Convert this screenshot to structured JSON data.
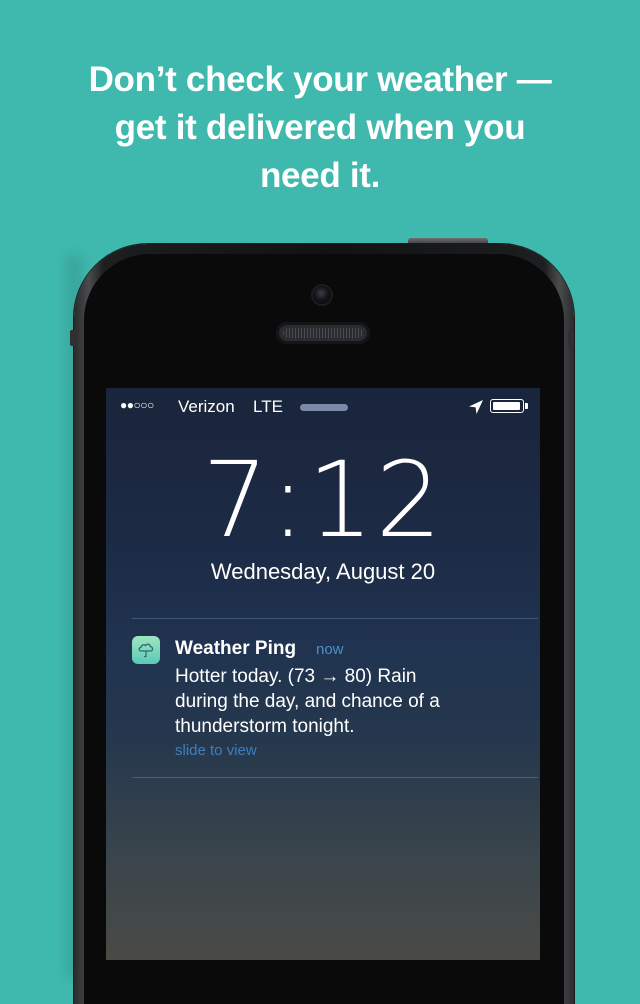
{
  "headline": {
    "lines": [
      "Don’t check your weather —",
      "get it delivered when you",
      "need it."
    ]
  },
  "colors": {
    "background": "#3fb8ad",
    "link_blue": "#4d8fc7",
    "text": "#ffffff"
  },
  "status_bar": {
    "signal": "●●○○○",
    "carrier": "Verizon",
    "network": "LTE",
    "icons": [
      "location-icon",
      "battery-icon"
    ],
    "battery_level": 1.0
  },
  "lock_screen": {
    "time": "7:12",
    "date": "Wednesday, August 20"
  },
  "notification": {
    "icon": "cloud-umbrella-icon",
    "app": "Weather Ping",
    "time": "now",
    "lines": [
      "Hotter today. (73 → 80) Rain",
      "during the day, and chance of a",
      "thunderstorm tonight."
    ],
    "action": "slide to view"
  }
}
